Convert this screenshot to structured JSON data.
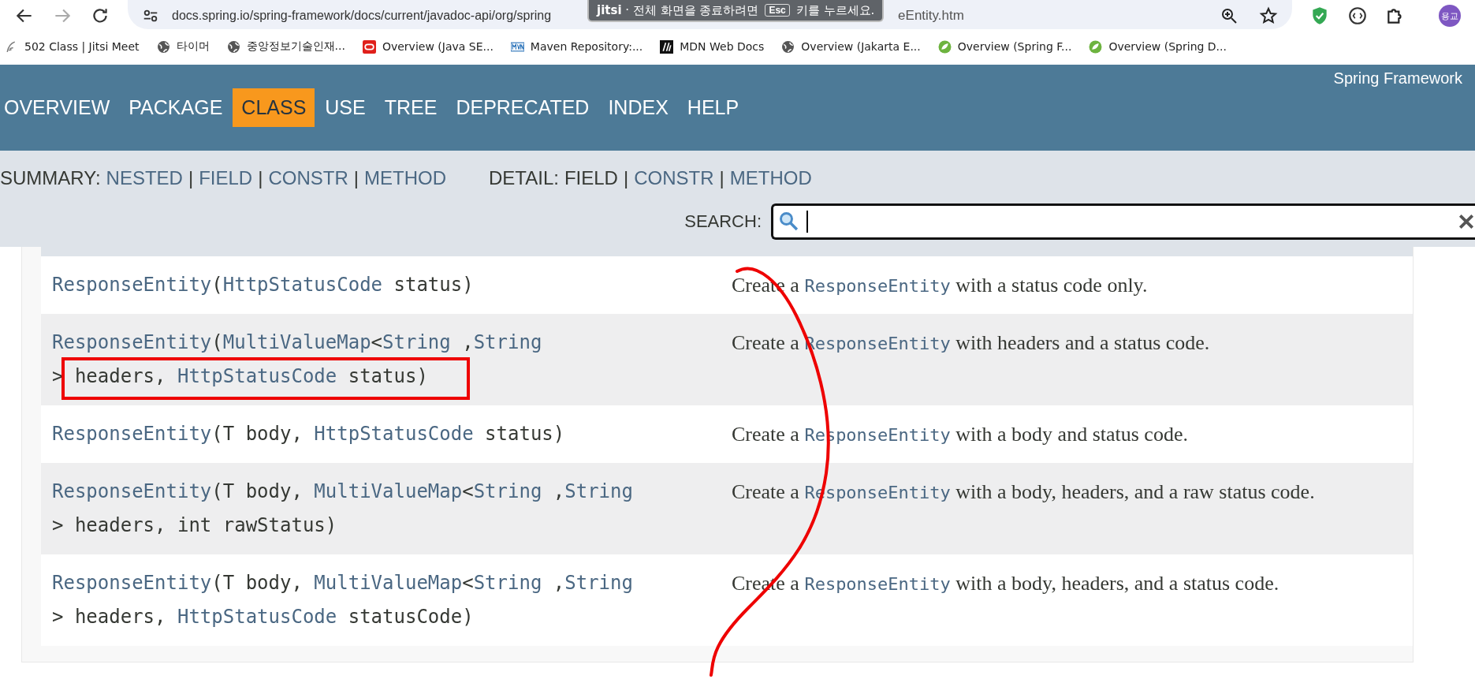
{
  "browser": {
    "url": "docs.spring.io/spring-framework/docs/current/javadoc-api/org/spring",
    "url_tail": "eEntity.htm",
    "fullscreen_notice": {
      "app": "jitsi",
      "before": "· 전체 화면을 종료하려면",
      "key": "Esc",
      "after": "키를 누르세요."
    },
    "profile": "용교",
    "bookmarks": [
      {
        "label": "502 Class | Jitsi Meet",
        "kind": "feather"
      },
      {
        "label": "타이머",
        "kind": "globe"
      },
      {
        "label": "중앙정보기술인재...",
        "kind": "globe"
      },
      {
        "label": "Overview (Java SE...",
        "kind": "oracle"
      },
      {
        "label": "Maven Repository:...",
        "kind": "maven"
      },
      {
        "label": "MDN Web Docs",
        "kind": "mdn"
      },
      {
        "label": "Overview (Jakarta E...",
        "kind": "globe"
      },
      {
        "label": "Overview (Spring F...",
        "kind": "spring"
      },
      {
        "label": "Overview (Spring D...",
        "kind": "spring"
      }
    ]
  },
  "header": {
    "brand": "Spring Framework",
    "nav": [
      {
        "label": "OVERVIEW",
        "selected": false
      },
      {
        "label": "PACKAGE",
        "selected": false
      },
      {
        "label": "CLASS",
        "selected": true
      },
      {
        "label": "USE",
        "selected": false
      },
      {
        "label": "TREE",
        "selected": false
      },
      {
        "label": "DEPRECATED",
        "selected": false
      },
      {
        "label": "INDEX",
        "selected": false
      },
      {
        "label": "HELP",
        "selected": false
      }
    ],
    "summary": [
      {
        "text": "SUMMARY:",
        "link": false
      },
      {
        "text": "NESTED",
        "link": true
      },
      {
        "text": "|",
        "link": false
      },
      {
        "text": "FIELD",
        "link": true
      },
      {
        "text": "|",
        "link": false
      },
      {
        "text": "CONSTR",
        "link": true
      },
      {
        "text": "|",
        "link": false
      },
      {
        "text": "METHOD",
        "link": true
      }
    ],
    "detail": [
      {
        "text": "DETAIL:",
        "link": false
      },
      {
        "text": "FIELD",
        "link": false
      },
      {
        "text": "|",
        "link": false
      },
      {
        "text": "CONSTR",
        "link": true
      },
      {
        "text": "|",
        "link": false
      },
      {
        "text": "METHOD",
        "link": true
      }
    ],
    "search": {
      "label": "SEARCH:"
    }
  },
  "constructors": [
    {
      "highlighted": false,
      "signature": [
        {
          "text": "ResponseEntity",
          "link": true
        },
        {
          "text": "(",
          "link": false
        },
        {
          "text": "HttpStatusCode",
          "link": true
        },
        {
          "text": " status)",
          "link": false
        }
      ],
      "description": [
        {
          "text": "Create a ",
          "code": false
        },
        {
          "text": "ResponseEntity",
          "code": true
        },
        {
          "text": " with a status code only.",
          "code": false
        }
      ]
    },
    {
      "highlighted": true,
      "signature": [
        {
          "text": "ResponseEntity",
          "link": true
        },
        {
          "text": "(",
          "link": false
        },
        {
          "text": "MultiValueMap",
          "link": true
        },
        {
          "text": "<",
          "link": false
        },
        {
          "text": "String",
          "link": true
        },
        {
          "text": " ,",
          "link": false
        },
        {
          "text": "String",
          "link": true
        },
        {
          "text": "\n> headers, ",
          "link": false
        },
        {
          "text": "HttpStatusCode",
          "link": true
        },
        {
          "text": " status)",
          "link": false
        }
      ],
      "description": [
        {
          "text": "Create a ",
          "code": false
        },
        {
          "text": "ResponseEntity",
          "code": true
        },
        {
          "text": " with headers and a status code.",
          "code": false
        }
      ]
    },
    {
      "highlighted": false,
      "signature": [
        {
          "text": "ResponseEntity",
          "link": true
        },
        {
          "text": "(T body, ",
          "link": false
        },
        {
          "text": "HttpStatusCode",
          "link": true
        },
        {
          "text": " status)",
          "link": false
        }
      ],
      "description": [
        {
          "text": "Create a ",
          "code": false
        },
        {
          "text": "ResponseEntity",
          "code": true
        },
        {
          "text": " with a body and status code.",
          "code": false
        }
      ]
    },
    {
      "highlighted": false,
      "signature": [
        {
          "text": "ResponseEntity",
          "link": true
        },
        {
          "text": "(T body, ",
          "link": false
        },
        {
          "text": "MultiValueMap",
          "link": true
        },
        {
          "text": "<",
          "link": false
        },
        {
          "text": "String",
          "link": true
        },
        {
          "text": " ,",
          "link": false
        },
        {
          "text": "String",
          "link": true
        },
        {
          "text": "\n> headers, int rawStatus)",
          "link": false
        }
      ],
      "description": [
        {
          "text": "Create a ",
          "code": false
        },
        {
          "text": "ResponseEntity",
          "code": true
        },
        {
          "text": " with a body, headers, and a raw status code.",
          "code": false
        }
      ]
    },
    {
      "highlighted": false,
      "signature": [
        {
          "text": "ResponseEntity",
          "link": true
        },
        {
          "text": "(T body, ",
          "link": false
        },
        {
          "text": "MultiValueMap",
          "link": true
        },
        {
          "text": "<",
          "link": false
        },
        {
          "text": "String",
          "link": true
        },
        {
          "text": " ,",
          "link": false
        },
        {
          "text": "String",
          "link": true
        },
        {
          "text": "\n> headers, ",
          "link": false
        },
        {
          "text": "HttpStatusCode",
          "link": true
        },
        {
          "text": " statusCode)",
          "link": false
        }
      ],
      "description": [
        {
          "text": "Create a ",
          "code": false
        },
        {
          "text": "ResponseEntity",
          "code": true
        },
        {
          "text": " with a body, headers, and a status code.",
          "code": false
        }
      ]
    }
  ],
  "annotations": [
    {
      "kind": "curve"
    }
  ]
}
